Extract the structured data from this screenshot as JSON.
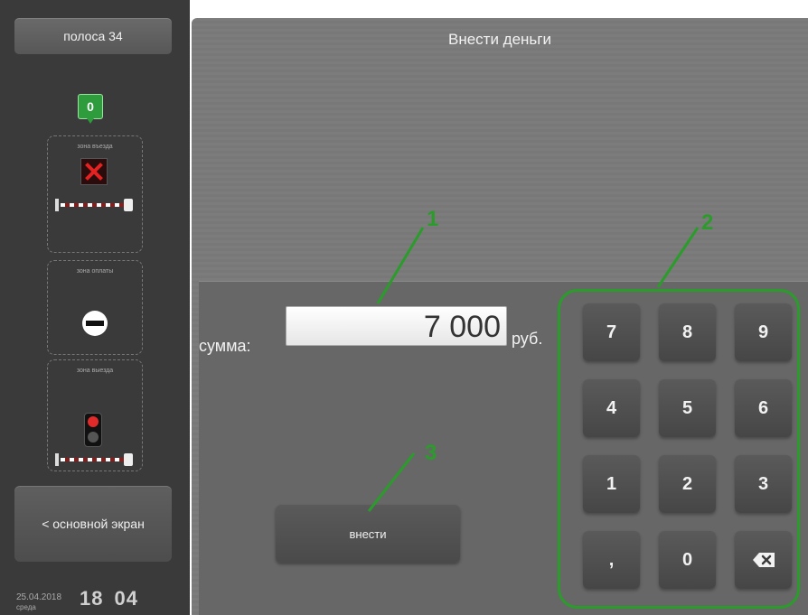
{
  "sidebar": {
    "lane_label": "полоса 34",
    "badge_count": "0",
    "zones": {
      "entry_label": "зона въезда",
      "pay_label": "зона оплаты",
      "exit_label": "зона выезда"
    },
    "main_screen_label": "< основной экран",
    "date": "25.04.2018",
    "weekday": "среда",
    "time_hours": "18",
    "time_minutes": "04"
  },
  "main": {
    "title": "Внести деньги",
    "amount_label": "сумма:",
    "amount_value": "7 000",
    "currency": "руб.",
    "submit_label": "внести",
    "keypad": {
      "keys": [
        "7",
        "8",
        "9",
        "4",
        "5",
        "6",
        "1",
        "2",
        "3",
        ",",
        "0"
      ],
      "backspace_icon": "backspace-icon"
    }
  },
  "annotations": {
    "marker_1": "1",
    "marker_2": "2",
    "marker_3": "3",
    "color": "#2b9c2b"
  },
  "colors": {
    "sidebar_bg": "#3a3a3a",
    "main_bg": "#7a7a7a",
    "badge_green": "#2e9b3c",
    "alert_red": "#e52222"
  }
}
